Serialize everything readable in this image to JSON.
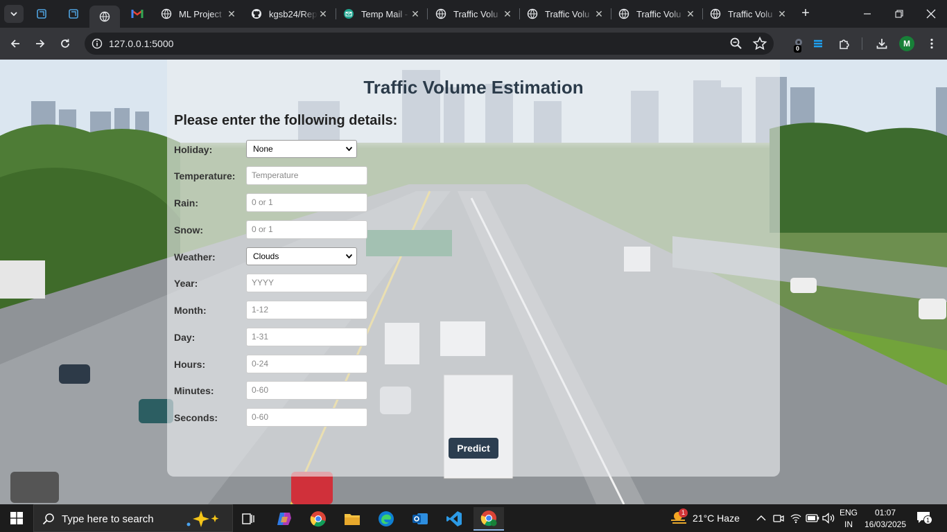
{
  "browser": {
    "tabs": [
      {
        "title": "ML Project",
        "icon": "gmail-icon"
      },
      {
        "title": "kgsb24/Rep",
        "icon": "github-icon"
      },
      {
        "title": "Temp Mail -",
        "icon": "tempmail-icon"
      },
      {
        "title": "Traffic Volu",
        "icon": "globe-icon"
      },
      {
        "title": "Traffic Volu",
        "icon": "globe-icon"
      },
      {
        "title": "Traffic Volu",
        "icon": "globe-icon"
      },
      {
        "title": "Traffic Volu",
        "icon": "globe-icon"
      }
    ],
    "url": "127.0.0.1:5000",
    "profile_initial": "M",
    "extension_badge": "0"
  },
  "page": {
    "title": "Traffic Volume Estimation",
    "subtitle": "Please enter the following details:",
    "fields": [
      {
        "label": "Holiday:",
        "type": "select",
        "value": "None"
      },
      {
        "label": "Temperature:",
        "type": "input",
        "placeholder": "Temperature"
      },
      {
        "label": "Rain:",
        "type": "input",
        "placeholder": "0 or 1"
      },
      {
        "label": "Snow:",
        "type": "input",
        "placeholder": "0 or 1"
      },
      {
        "label": "Weather:",
        "type": "select",
        "value": "Clouds"
      },
      {
        "label": "Year:",
        "type": "input",
        "placeholder": "YYYY"
      },
      {
        "label": "Month:",
        "type": "input",
        "placeholder": "1-12"
      },
      {
        "label": "Day:",
        "type": "input",
        "placeholder": "1-31"
      },
      {
        "label": "Hours:",
        "type": "input",
        "placeholder": "0-24"
      },
      {
        "label": "Minutes:",
        "type": "input",
        "placeholder": "0-60"
      },
      {
        "label": "Seconds:",
        "type": "input",
        "placeholder": "0-60"
      }
    ],
    "predict_label": "Predict"
  },
  "taskbar": {
    "search_placeholder": "Type here to search",
    "weather": "21°C  Haze",
    "weather_badge": "1",
    "lang_1": "ENG",
    "lang_2": "IN",
    "time": "01:07",
    "date": "16/03/2025",
    "notification_count": "1"
  }
}
